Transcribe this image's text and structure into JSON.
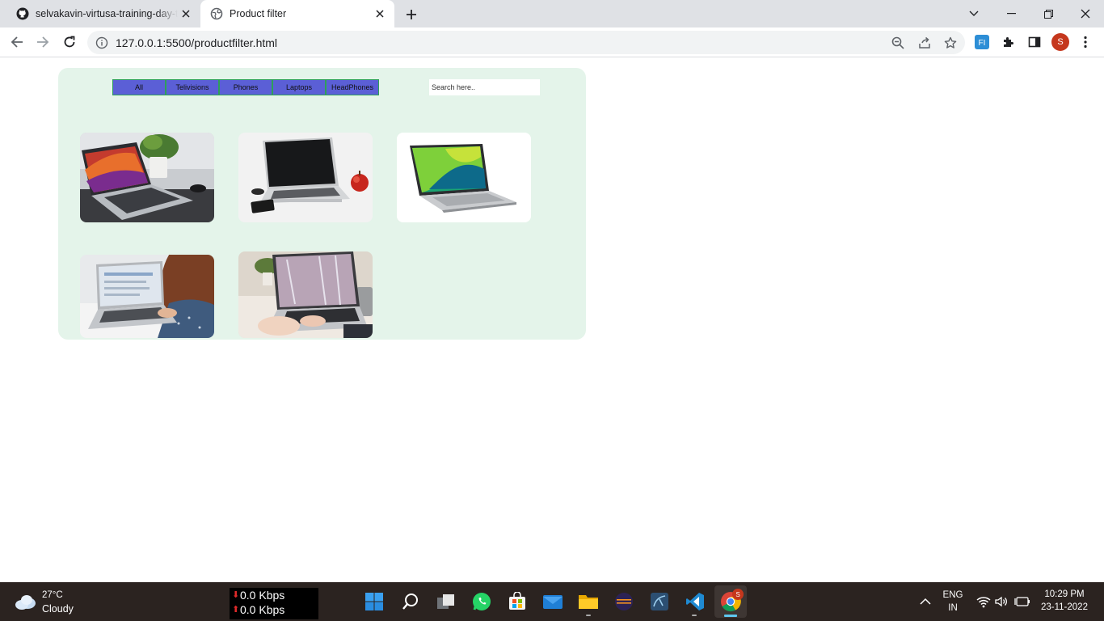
{
  "browser": {
    "tabs": [
      {
        "title": "selvakavin-virtusa-training-day-task",
        "favicon": "github-icon"
      },
      {
        "title": "Product filter",
        "favicon": "globe-icon"
      }
    ],
    "url": "127.0.0.1:5500/productfilter.html",
    "profile_initial": "S",
    "extension_label": "FI"
  },
  "page": {
    "filters": [
      "All",
      "Telivisions",
      "Phones",
      "Laptops",
      "HeadPhones"
    ],
    "search_placeholder": "Search here..",
    "products": [
      {
        "image": "laptop-on-desk-with-plant"
      },
      {
        "image": "laptop-with-apple"
      },
      {
        "image": "acer-laptop-green-screen"
      },
      {
        "image": "woman-using-laptop"
      },
      {
        "image": "hands-typing-laptop"
      }
    ],
    "colors": {
      "panel": "#e4f4ea",
      "filter_button": "#5b5fd6",
      "filter_border": "#2ea05a"
    }
  },
  "taskbar": {
    "weather": {
      "temp": "27°C",
      "condition": "Cloudy"
    },
    "network": {
      "down": "0.0 Kbps",
      "up": "0.0 Kbps"
    },
    "language": {
      "line1": "ENG",
      "line2": "IN"
    },
    "clock": {
      "time": "10:29 PM",
      "date": "23-11-2022"
    },
    "chrome_badge": "S"
  }
}
